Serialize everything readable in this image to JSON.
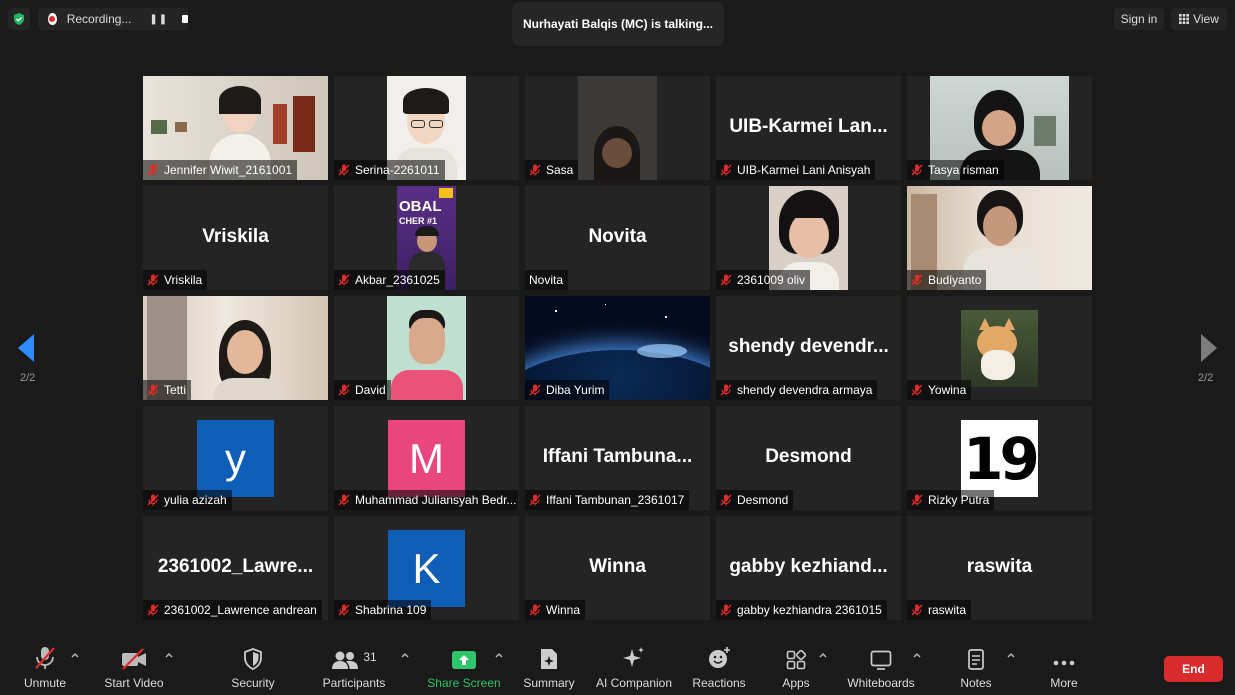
{
  "topbar": {
    "recording_label": "Recording...",
    "talking_text": "Nurhayati Balqis (MC) is talking...",
    "sign_in_label": "Sign in",
    "view_label": "View"
  },
  "pagination": {
    "left_page": "2/2",
    "right_page": "2/2"
  },
  "tiles": [
    {
      "name": "Jennifer Wiwit_2161001"
    },
    {
      "name": "Serina-2261011"
    },
    {
      "name": "Sasa"
    },
    {
      "name": "UIB-Karmei Lani Anisyah",
      "display": "UIB-Karmei Lan..."
    },
    {
      "name": "Tasya risman"
    },
    {
      "name": "Vriskila",
      "display": "Vriskila"
    },
    {
      "name": "Akbar_2361025"
    },
    {
      "name": "Novita",
      "display": "Novita"
    },
    {
      "name": "2361009 oliv"
    },
    {
      "name": "Budiyanto"
    },
    {
      "name": "Tetti"
    },
    {
      "name": "David"
    },
    {
      "name": "Diba Yurim"
    },
    {
      "name": "shendy devendra armaya",
      "display": "shendy devendr..."
    },
    {
      "name": "Yowina"
    },
    {
      "name": "yulia azizah",
      "avatar_letter": "y",
      "avatar_color": "#0e5eb8"
    },
    {
      "name": "Muhammad Juliansyah Bedr...",
      "avatar_letter": "M",
      "avatar_color": "#e8467c"
    },
    {
      "name": "Iffani Tambunan_2361017",
      "display": "Iffani Tambuna..."
    },
    {
      "name": "Desmond",
      "display": "Desmond"
    },
    {
      "name": "Rizky Putra",
      "avatar_letter": "19"
    },
    {
      "name": "2361002_Lawrence andrean",
      "display": "2361002_Lawre..."
    },
    {
      "name": "Shabrina 109",
      "avatar_letter": "K",
      "avatar_color": "#0e5eb8"
    },
    {
      "name": "Winna",
      "display": "Winna"
    },
    {
      "name": "gabby kezhiandra 2361015",
      "display": "gabby kezhiand..."
    },
    {
      "name": "raswita",
      "display": "raswita"
    }
  ],
  "video_tiles": {
    "akbar_banner_line1": "OBAL",
    "akbar_banner_line2": "CHER #1"
  },
  "toolbar": {
    "participants_count": "31",
    "items": [
      {
        "label": "Unmute"
      },
      {
        "label": "Start Video"
      },
      {
        "label": "Security"
      },
      {
        "label": "Participants"
      },
      {
        "label": "Share Screen"
      },
      {
        "label": "Summary"
      },
      {
        "label": "AI Companion"
      },
      {
        "label": "Reactions"
      },
      {
        "label": "Apps"
      },
      {
        "label": "Whiteboards"
      },
      {
        "label": "Notes"
      },
      {
        "label": "More"
      }
    ],
    "end_label": "End"
  },
  "colors": {
    "background": "#1a1a1a",
    "tile": "#242424",
    "share_green": "#2ec46a",
    "end_red": "#d92b2b",
    "nav_blue": "#2d8cff",
    "mic_off_red": "#e02b2b"
  }
}
